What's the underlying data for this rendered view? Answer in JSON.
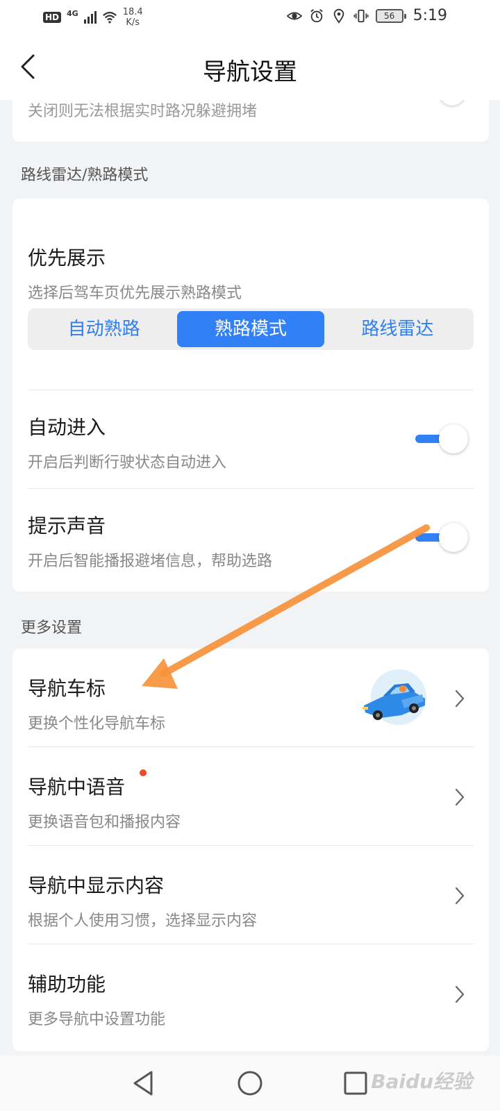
{
  "status_bar": {
    "hd": "HD",
    "network": "4G",
    "speed_value": "18.4",
    "speed_unit": "K/s",
    "battery": "56",
    "time": "5:19"
  },
  "header": {
    "title": "导航设置"
  },
  "top_card": {
    "clipped_subtitle": "关闭则无法根据实时路况躲避拥堵"
  },
  "route_section": {
    "label": "路线雷达/熟路模式",
    "priority": {
      "title": "优先展示",
      "subtitle": "选择后驾车页优先展示熟路模式",
      "options": [
        "自动熟路",
        "熟路模式",
        "路线雷达"
      ],
      "selected": "熟路模式"
    },
    "auto_enter": {
      "title": "自动进入",
      "subtitle": "开启后判断行驶状态自动进入",
      "enabled": true
    },
    "sound": {
      "title": "提示声音",
      "subtitle": "开启后智能播报避堵信息，帮助选路",
      "enabled": true
    }
  },
  "more_section": {
    "label": "更多设置",
    "items": [
      {
        "title": "导航车标",
        "subtitle": "更换个性化导航车标"
      },
      {
        "title": "导航中语音",
        "subtitle": "更换语音包和播报内容",
        "has_dot": true
      },
      {
        "title": "导航中显示内容",
        "subtitle": "根据个人使用习惯，选择显示内容"
      },
      {
        "title": "辅助功能",
        "subtitle": "更多导航中设置功能"
      }
    ]
  },
  "watermark": "Baidu经验",
  "colors": {
    "accent": "#3280f6",
    "arrow": "#f7933b",
    "dot": "#f04a2a"
  }
}
